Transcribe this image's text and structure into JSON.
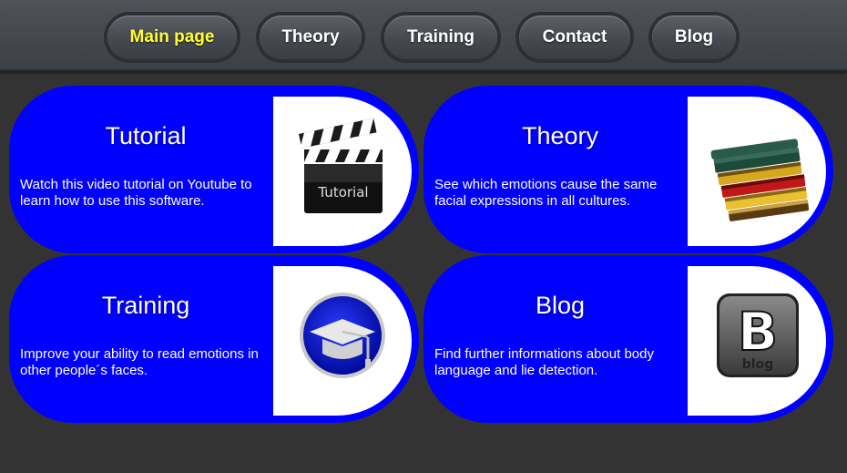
{
  "nav": {
    "items": [
      {
        "label": "Main page",
        "active": true
      },
      {
        "label": "Theory",
        "active": false
      },
      {
        "label": "Training",
        "active": false
      },
      {
        "label": "Contact",
        "active": false
      },
      {
        "label": "Blog",
        "active": false
      }
    ],
    "active_color": "#ffff33"
  },
  "cards": [
    {
      "title": "Tutorial",
      "description": "Watch this video tutorial on Youtube to learn how to use this software.",
      "icon": "clapperboard-icon",
      "icon_text": "Tutorial"
    },
    {
      "title": "Theory",
      "description": "See which emotions cause the same facial expressions in all cultures.",
      "icon": "books-icon"
    },
    {
      "title": "Training",
      "description": "Improve your ability to read emotions in other people´s faces.",
      "icon": "graduation-cap-icon"
    },
    {
      "title": "Blog",
      "description": "Find further informations about body language and lie detection.",
      "icon": "blog-icon",
      "icon_text": "blog"
    }
  ],
  "colors": {
    "card": "#0000ff",
    "background": "#333333"
  }
}
